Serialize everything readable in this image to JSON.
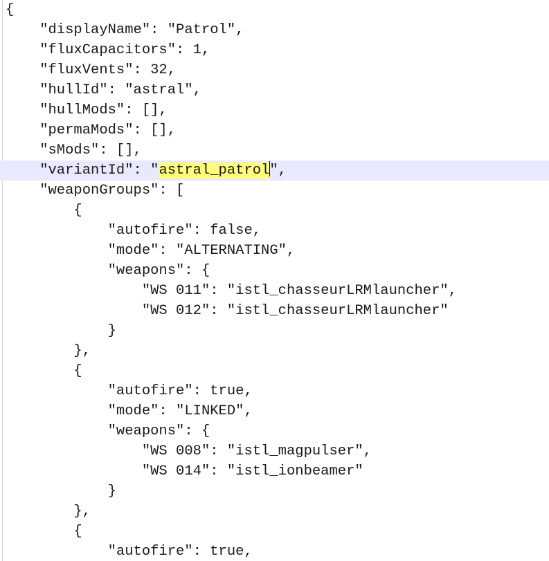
{
  "editor": {
    "lines": [
      "{",
      "    \"displayName\": \"Patrol\",",
      "    \"fluxCapacitors\": 1,",
      "    \"fluxVents\": 32,",
      "    \"hullId\": \"astral\",",
      "    \"hullMods\": [],",
      "    \"permaMods\": [],",
      "    \"sMods\": [],",
      "    \"variantId\": \"",
      "    \"weaponGroups\": [",
      "        {",
      "            \"autofire\": false,",
      "            \"mode\": \"ALTERNATING\",",
      "            \"weapons\": {",
      "                \"WS 011\": \"istl_chasseurLRMlauncher\",",
      "                \"WS 012\": \"istl_chasseurLRMlauncher\"",
      "            }",
      "        },",
      "        {",
      "            \"autofire\": true,",
      "            \"mode\": \"LINKED\",",
      "            \"weapons\": {",
      "                \"WS 008\": \"istl_magpulser\",",
      "                \"WS 014\": \"istl_ionbeamer\"",
      "            }",
      "        },",
      "        {",
      "            \"autofire\": true,"
    ],
    "current_line_highlighted_text": "astral_patrol",
    "current_line_suffix": "\","
  }
}
